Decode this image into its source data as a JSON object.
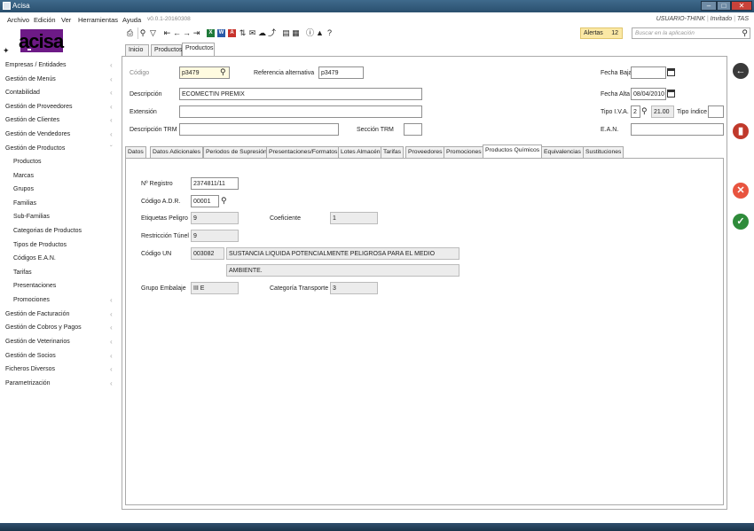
{
  "window": {
    "title": "Acisa"
  },
  "menu": {
    "items": [
      "Archivo",
      "Edición",
      "Ver",
      "Herramientas",
      "Ayuda"
    ],
    "version": "v0.0.1-20160308",
    "user": "USUARIO-THINK",
    "role": "Invitado",
    "company": "TAS"
  },
  "logo": {
    "text": "acisa"
  },
  "alerts": {
    "label": "Alertas",
    "count": "12"
  },
  "search": {
    "placeholder": "Buscar en la aplicación"
  },
  "tabs": [
    "Inicio",
    "Productos",
    "Productos"
  ],
  "sidebar": {
    "items": [
      {
        "label": "Empresas / Entidades"
      },
      {
        "label": "Gestión de Menús"
      },
      {
        "label": "Contabilidad"
      },
      {
        "label": "Gestión de Proveedores"
      },
      {
        "label": "Gestión de Clientes"
      },
      {
        "label": "Gestión de Vendedores"
      },
      {
        "label": "Gestión de Productos"
      }
    ],
    "subitems": [
      "Productos",
      "Marcas",
      "Grupos",
      "Familias",
      "Sub-Familias",
      "Categorias de Productos",
      "Tipos de Productos",
      "Códigos E.A.N.",
      "Tarifas",
      "Presentaciones",
      "Promociones"
    ],
    "items2": [
      "Gestión de Facturación",
      "Gestión de Cobros y Pagos",
      "Gestión de Veterinarios",
      "Gestión de Socios",
      "Ficheros Diversos",
      "Parametrización"
    ]
  },
  "form": {
    "codigo_label": "Código",
    "codigo": "p3479",
    "ref_alt_label": "Referencia alternativa",
    "ref_alt": "p3479",
    "fecha_baja_label": "Fecha Baja",
    "fecha_baja": "",
    "descripcion_label": "Descripción",
    "descripcion": "ECOMECTIN PREMIX",
    "fecha_alta_label": "Fecha Alta",
    "fecha_alta": "08/04/2010",
    "extension_label": "Extensión",
    "extension": "",
    "tipo_iva_label": "Tipo I.V.A.",
    "tipo_iva": "2",
    "tipo_iva_pct": "21.00",
    "tipo_indice_label": "Tipo índice",
    "tipo_indice": "",
    "desc_trm_label": "Descripción TRM",
    "desc_trm": "",
    "seccion_trm_label": "Sección TRM",
    "seccion_trm": "",
    "ean_label": "E.A.N.",
    "ean": ""
  },
  "subtabs": [
    "Datos",
    "Datos Adicionales",
    "Periodos de Supresión",
    "Presentaciones/Formatos",
    "Lotes Almacén",
    "Tarifas",
    "Proveedores",
    "Promociones",
    "Productos Químicos",
    "Equivalencias",
    "Sustituciones"
  ],
  "quimicos": {
    "registro_label": "Nº Registro",
    "registro": "2374811/11",
    "adr_label": "Código A.D.R.",
    "adr": "00001",
    "etiquetas_label": "Etiquetas Peligro",
    "etiquetas": "9",
    "coef_label": "Coeficiente",
    "coef": "1",
    "restriccion_label": "Restricción Túnel",
    "restriccion": "9",
    "un_label": "Código UN",
    "un_code": "003082",
    "un_desc1": "SUSTANCIA LIQUIDA POTENCIALMENTE PELIGROSA PARA EL MEDIO",
    "un_desc2": "AMBIENTE.",
    "embalaje_label": "Grupo Embalaje",
    "embalaje": "III E",
    "categoria_label": "Categoría Transporte",
    "categoria": "3"
  },
  "colors": {
    "back": "#3a3a3a",
    "delete": "#c0392b",
    "cancel": "#e8543f",
    "confirm": "#2e8b3a"
  }
}
